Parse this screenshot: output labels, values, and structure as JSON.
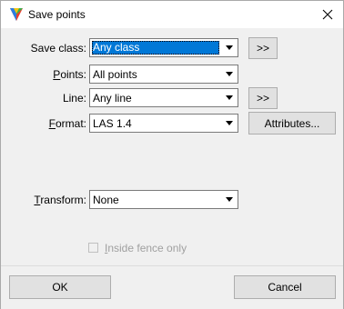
{
  "window": {
    "title": "Save points",
    "close_glyph": "✕"
  },
  "fields": {
    "save_class": {
      "label_underlined": "",
      "label_rest": "Save class:",
      "value": "Any class",
      "button": ">>"
    },
    "points": {
      "label_underlined": "P",
      "label_rest": "oints:",
      "value": "All points"
    },
    "line": {
      "label_underlined": "",
      "label_rest": "Line:",
      "value": "Any line",
      "button": ">>"
    },
    "format": {
      "label_underlined": "F",
      "label_rest": "ormat:",
      "value": "LAS 1.4",
      "button": "Attributes..."
    },
    "transform": {
      "label_underlined": "T",
      "label_rest": "ransform:",
      "value": "None"
    }
  },
  "inside_fence": {
    "label_underlined": "I",
    "label_rest": "nside fence only",
    "checked": false,
    "enabled": false
  },
  "footer": {
    "ok_label": "OK",
    "cancel_label": "Cancel"
  },
  "colors": {
    "accent": "#0078d7",
    "window_bg": "#f0f0f0",
    "disabled_text": "#a0a0a0"
  },
  "icons": {
    "app": "terrasolid-triangle-icon",
    "close": "close-icon",
    "dropdown": "chevron-down-icon"
  }
}
